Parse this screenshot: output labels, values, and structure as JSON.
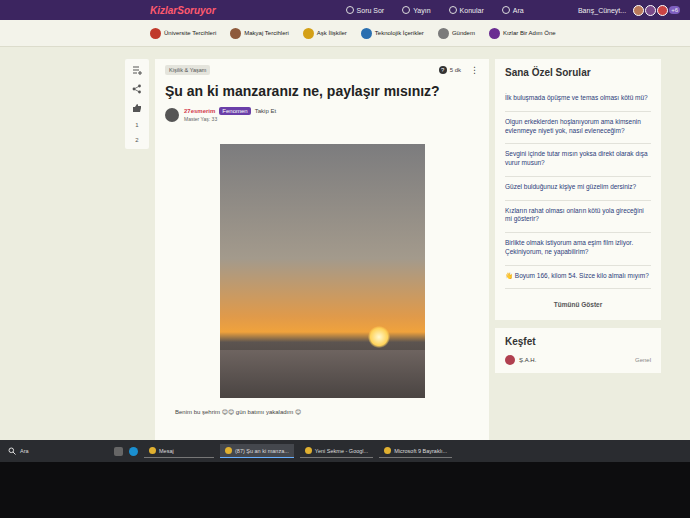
{
  "header": {
    "logo": "KizlarSoruyor",
    "nav": [
      "Soru Sor",
      "Yayın",
      "Konular",
      "Ara"
    ],
    "user": "Barış_Cüneyt...",
    "avatar_count": "+6"
  },
  "categories": [
    {
      "label": "Üniversite Tercihleri",
      "color": "#c0392b"
    },
    {
      "label": "Makyaj Tercihleri",
      "color": "#8e5a3c"
    },
    {
      "label": "Aşk İlişkiler",
      "color": "#d4a017"
    },
    {
      "label": "Teknolojik İçerikler",
      "color": "#2a6fb0"
    },
    {
      "label": "Gündem",
      "color": "#7a7a7a"
    },
    {
      "label": "Kızlar Bir Adım Öne",
      "color": "#6a2c91"
    }
  ],
  "rail": {
    "counts": [
      "1",
      "2"
    ]
  },
  "post": {
    "tag": "Kişilik & Yaşam",
    "time": "5 dk",
    "title": "Şu an ki manzaranız ne, paylaşır mısınız?",
    "author": "27esmerim",
    "badge": "Fenomen",
    "follow": "Takip Et",
    "meta": "Master Yaş: 33",
    "caption": "Benim bu şehrim 😊😊 gün batımı yakaladım 😊"
  },
  "sidebar": {
    "title": "Sana Özel Sorular",
    "questions": [
      "İlk buluşmada öpüşme ve temas olması kötü mü?",
      "Olgun erkeklerden hoşlanıyorum ama kimsenin evlenmeye niyeti yok, nasıl evleneceğim?",
      "Sevgini içinde tutar mısın yoksa direkt olarak dışa vurur musun?",
      "Güzel bulduğunuz kişiye mi güzelim dersiniz?",
      "Kızların rahat olması onların kötü yola gireceğini mi gösterir?",
      "Birlikte olmak istiyorum ama eşim film izliyor. Çekiniyorum, ne yapabilirim?",
      "👋 Boyum 166, kilom 54. Sizce kilo almalı mıyım?"
    ],
    "show_all": "Tümünü Göster"
  },
  "explore": {
    "title": "Keşfet",
    "user": "Ş.A.H.",
    "sub": "Genel"
  },
  "taskbar": {
    "search": "Ara",
    "items": [
      {
        "label": "Mesaj",
        "selected": false
      },
      {
        "label": "(87) Şu an ki manza...",
        "selected": true
      },
      {
        "label": "Yeni Sekme - Googl...",
        "selected": false
      },
      {
        "label": "Microsoft 9 Bayraklı...",
        "selected": false
      }
    ]
  }
}
